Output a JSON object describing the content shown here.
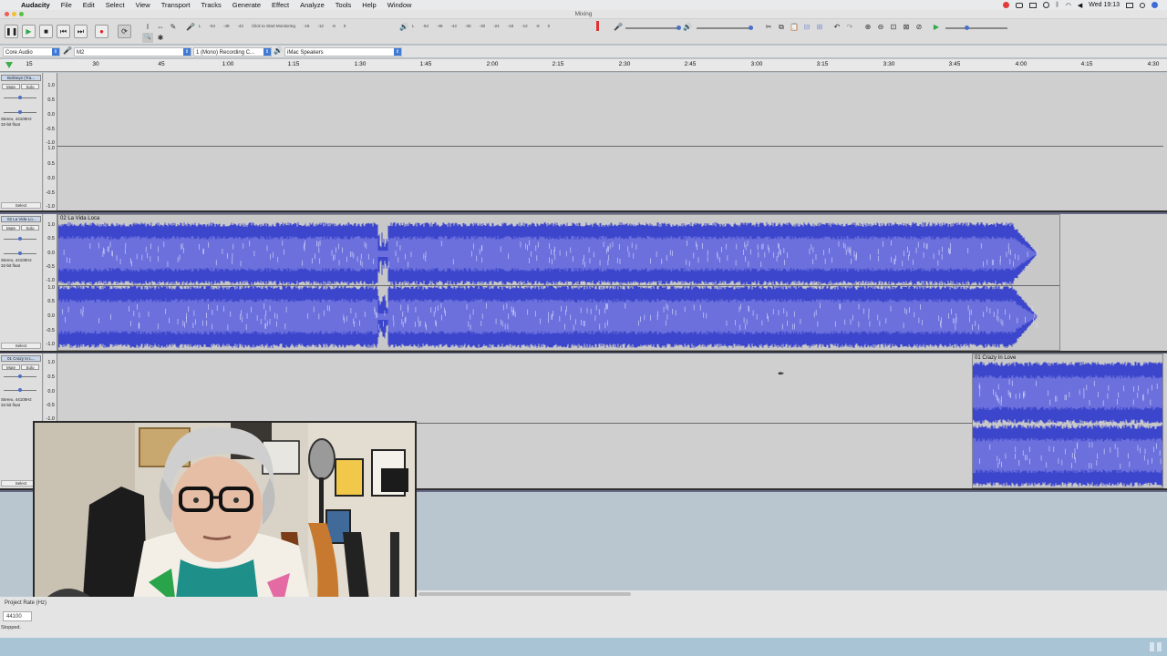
{
  "menubar": {
    "app_name": "Audacity",
    "items": [
      "File",
      "Edit",
      "Select",
      "View",
      "Transport",
      "Tracks",
      "Generate",
      "Effect",
      "Analyze",
      "Tools",
      "Help",
      "Window"
    ],
    "clock": "Wed 19:13"
  },
  "window": {
    "title": "Mixing"
  },
  "toolbar": {
    "pause_glyph": "❚❚",
    "play_glyph": "▶",
    "stop_glyph": "■",
    "skip_start_glyph": "⏮",
    "skip_end_glyph": "⏭",
    "record_glyph": "●",
    "loop_glyph": "⟳",
    "select_tool_glyph": "I",
    "envelope_tool_glyph": "⇔",
    "draw_tool_glyph": "✎",
    "zoom_tool_glyph": "🔍",
    "multi_tool_glyph": "✱",
    "mic_glyph": "🎤",
    "speaker_glyph": "🔊",
    "record_meter_labels": [
      "L",
      "R",
      "-54",
      "-48",
      "-42",
      "Click to Start Monitoring",
      "-18",
      "-12",
      "-6",
      "0"
    ],
    "play_meter_labels": [
      "L",
      "R",
      "-54",
      "-48",
      "-42",
      "-36",
      "-30",
      "-24",
      "-18",
      "-12",
      "-6",
      "0"
    ],
    "edit_glyphs": [
      "✂",
      "⧉",
      "📋",
      "⊟",
      "⊞"
    ],
    "undo_glyph": "↶",
    "redo_glyph": "↷",
    "zoom_glyphs": [
      "⊕",
      "⊖",
      "⊡",
      "⊠",
      "⊘"
    ],
    "play_at_speed_glyph": "▶"
  },
  "devices": {
    "host": "Core Audio",
    "input_device": "M2",
    "channels": "1 (Mono) Recording C...",
    "output_device": "iMac Speakers"
  },
  "ruler": {
    "ticks": [
      {
        "label": "15",
        "pos": 32
      },
      {
        "label": "30",
        "pos": 105
      },
      {
        "label": "45",
        "pos": 177
      },
      {
        "label": "1:00",
        "pos": 250
      },
      {
        "label": "1:15",
        "pos": 322
      },
      {
        "label": "1:30",
        "pos": 395
      },
      {
        "label": "1:45",
        "pos": 467
      },
      {
        "label": "2:00",
        "pos": 540
      },
      {
        "label": "2:15",
        "pos": 612
      },
      {
        "label": "2:30",
        "pos": 685
      },
      {
        "label": "2:45",
        "pos": 757
      },
      {
        "label": "3:00",
        "pos": 830
      },
      {
        "label": "3:15",
        "pos": 902
      },
      {
        "label": "3:30",
        "pos": 975
      },
      {
        "label": "3:45",
        "pos": 1047
      },
      {
        "label": "4:00",
        "pos": 1120
      },
      {
        "label": "4:15",
        "pos": 1192
      },
      {
        "label": "4:30",
        "pos": 1265
      }
    ]
  },
  "tracks": [
    {
      "name": "Bullseye (Tra...",
      "mute": "Mute",
      "solo": "Solo",
      "format": "Stereo, 44100Hz",
      "bits": "32-bit float",
      "select": "Select",
      "scale": [
        "1.0",
        "0.5",
        "0.0",
        "-0.5",
        "-1.0",
        "1.0",
        "0.5",
        "0.0",
        "-0.5",
        "-1.0"
      ],
      "clips": []
    },
    {
      "name": "02 La Vida Lo...",
      "mute": "Mute",
      "solo": "Solo",
      "format": "Stereo, 44100Hz",
      "bits": "32-bit float",
      "select": "Select",
      "scale": [
        "1.0",
        "0.5",
        "0.0",
        "-0.5",
        "-1.0",
        "1.0",
        "0.5",
        "0.0",
        "-0.5",
        "-1.0"
      ],
      "clips": [
        {
          "name": "02 La Vida Loca"
        }
      ]
    },
    {
      "name": "01 Crazy In L...",
      "mute": "Mute",
      "solo": "Solo",
      "format": "Stereo, 44100Hz",
      "bits": "32-bit float",
      "select": "Select",
      "scale": [
        "1.0",
        "0.5",
        "0.0",
        "-0.5",
        "-1.0"
      ],
      "clips": [
        {
          "name": "01 Crazy In Love"
        }
      ]
    }
  ],
  "statusbar": {
    "rate_label": "Project Rate (Hz)",
    "rate": "44100",
    "state": "Stopped."
  },
  "colors": {
    "waveform": "#3c46cc",
    "waveform_rms": "#6b70dc",
    "waveform_peak": "#e6e6ff",
    "track_bg": "#cfcfcf",
    "empty_area": "#666a86"
  }
}
